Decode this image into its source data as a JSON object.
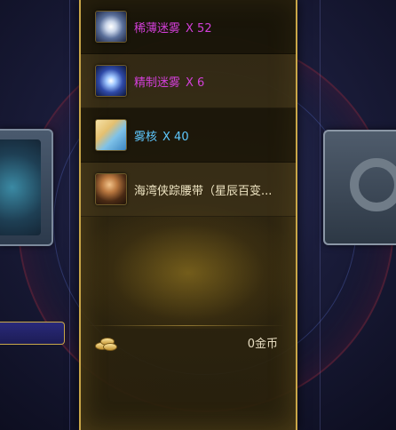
{
  "rewards": [
    {
      "name": "稀薄迷雾",
      "qty": "X 52",
      "color": "#d23fd8",
      "icon": "mist-thin-icon"
    },
    {
      "name": "精制迷雾",
      "qty": "X 6",
      "color": "#d23fd8",
      "icon": "mist-refined-icon"
    },
    {
      "name": "雾核",
      "qty": "X 40",
      "color": "#5ec8ff",
      "icon": "mist-core-icon"
    },
    {
      "name": "海湾侠踪腰带（星辰百变...",
      "qty": "",
      "color": "#f0e6c4",
      "icon": "belt-icon"
    }
  ],
  "footer": {
    "gold": "0金币",
    "icon": "gold-coins-icon"
  },
  "colors": {
    "panel_border": "#c9a648",
    "background": "#1a1c3a"
  }
}
